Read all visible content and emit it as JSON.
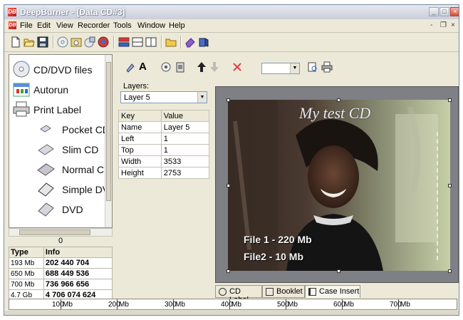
{
  "window": {
    "title": "DeepBurner - [Data CD#3]",
    "app_icon": "DB"
  },
  "menubar": {
    "items": [
      "File",
      "Edit",
      "View",
      "Recorder",
      "Tools",
      "Window",
      "Help"
    ],
    "mdi_controls": [
      "-",
      "❐",
      "×"
    ]
  },
  "toolbar": {
    "icons": [
      "new-icon",
      "open-icon",
      "save-icon",
      "disc-icon",
      "burn-icon",
      "copy-disc-icon",
      "cd-label-icon",
      "layout-icon",
      "layout-alt-icon",
      "panel-icon",
      "folder-icon",
      "erase-icon",
      "info-icon"
    ]
  },
  "left_pane": {
    "items": [
      {
        "label": "CD/DVD files",
        "icon": "cd-dvd-icon"
      },
      {
        "label": "Autorun",
        "icon": "autorun-icon"
      },
      {
        "label": "Print Label",
        "icon": "printer-icon"
      },
      {
        "label": "Pocket CD",
        "icon": "pocket-cd-icon"
      },
      {
        "label": "Slim CD",
        "icon": "slim-cd-icon"
      },
      {
        "label": "Normal CD",
        "icon": "normal-cd-icon"
      },
      {
        "label": "Simple DVD",
        "icon": "simple-dvd-icon"
      },
      {
        "label": "DVD",
        "icon": "dvd-icon"
      }
    ],
    "counter": "0"
  },
  "info_table": {
    "headers": [
      "Type",
      "Info"
    ],
    "rows": [
      {
        "type": "193 Mb",
        "info": "202 440 704"
      },
      {
        "type": "650 Mb",
        "info": "688 449 536"
      },
      {
        "type": "700 Mb",
        "info": "736 966 656"
      },
      {
        "type": "4.7 Gb",
        "info": "4 706 074 624"
      }
    ]
  },
  "label_toolbar": {
    "icons": [
      "paint-icon",
      "text-icon",
      "image-icon",
      "clipboard-icon",
      "arrow-up-icon",
      "arrow-down-icon",
      "delete-icon",
      "print-preview-icon",
      "print-icon"
    ],
    "dropdown_value": ""
  },
  "layers": {
    "label": "Layers:",
    "selected": "Layer 5",
    "prop_headers": [
      "Key",
      "Value"
    ],
    "props": [
      {
        "key": "Name",
        "value": "Layer 5"
      },
      {
        "key": "Left",
        "value": "1"
      },
      {
        "key": "Top",
        "value": "1"
      },
      {
        "key": "Width",
        "value": "3533"
      },
      {
        "key": "Height",
        "value": "2753"
      }
    ]
  },
  "canvas": {
    "title": "My test CD",
    "lines": [
      "File 1 - 220 Mb",
      "File2 - 10 Mb"
    ]
  },
  "tabs": [
    {
      "label": "CD Label",
      "icon": "disc-icon",
      "active": false
    },
    {
      "label": "Booklet",
      "icon": "booklet-icon",
      "active": false
    },
    {
      "label": "Case Insert",
      "icon": "case-insert-icon",
      "active": true
    }
  ],
  "ruler": {
    "labels": [
      "100",
      "Mb",
      "200",
      "Mb",
      "300",
      "Mb",
      "400",
      "Mb",
      "500",
      "Mb",
      "600",
      "Mb",
      "700",
      "Mb"
    ]
  },
  "colors": {
    "title_gradient_top": "#e6e8ee",
    "chrome": "#ece9d8",
    "canvas_bg": "#7f7f86",
    "accent_red": "#d94c32"
  }
}
